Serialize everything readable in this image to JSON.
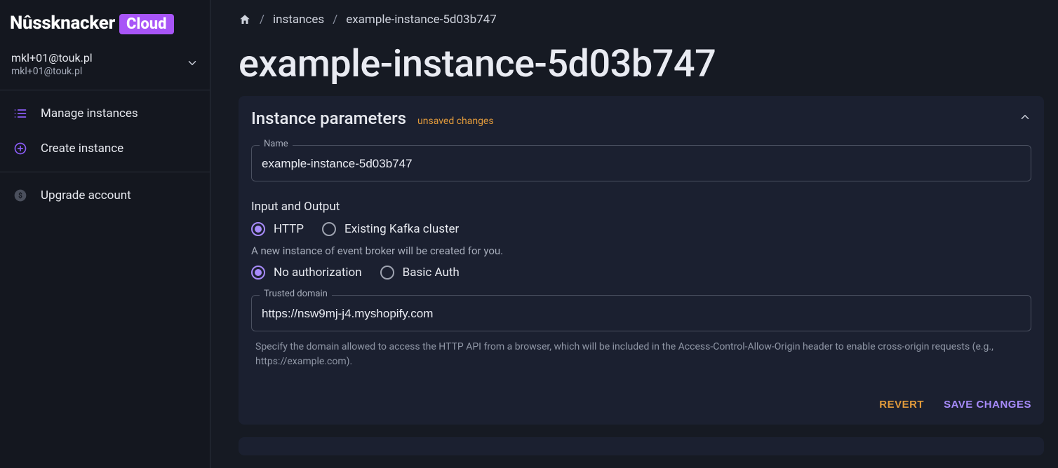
{
  "brand": {
    "word": "Nûssknacker",
    "badge": "Cloud"
  },
  "user": {
    "name": "mkl+01@touk.pl",
    "email": "mkl+01@touk.pl"
  },
  "sidebar": {
    "items": [
      {
        "label": "Manage instances"
      },
      {
        "label": "Create instance"
      }
    ],
    "upgrade_label": "Upgrade account"
  },
  "breadcrumb": {
    "items": [
      {
        "label": "instances"
      },
      {
        "label": "example-instance-5d03b747"
      }
    ]
  },
  "page": {
    "title": "example-instance-5d03b747"
  },
  "panel": {
    "title": "Instance parameters",
    "unsaved": "unsaved changes",
    "name_label": "Name",
    "name_value": "example-instance-5d03b747",
    "io_label": "Input and Output",
    "radios_io": {
      "http": "HTTP",
      "kafka": "Existing Kafka cluster"
    },
    "io_hint": "A new instance of event broker will be created for you.",
    "radios_auth": {
      "none": "No authorization",
      "basic": "Basic Auth"
    },
    "trusted_label": "Trusted domain",
    "trusted_value": "https://nsw9mj-j4.myshopify.com",
    "trusted_help": "Specify the domain allowed to access the HTTP API from a browser, which will be included in the Access-Control-Allow-Origin header to enable cross-origin requests (e.g., https://example.com).",
    "revert": "REVERT",
    "save": "SAVE CHANGES"
  }
}
